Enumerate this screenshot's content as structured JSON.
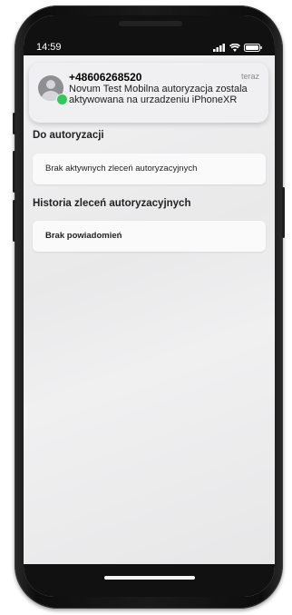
{
  "status_bar": {
    "time": "14:59",
    "signal_icon": "cellular-signal-icon",
    "wifi_icon": "wifi-icon",
    "battery_icon": "battery-icon"
  },
  "notification": {
    "sender": "+48606268520",
    "time": "teraz",
    "message": "Novum Test Mobilna autoryzacja zostala aktywowana na urzadzeniu iPhoneXR",
    "avatar_icon": "contact-avatar-icon",
    "badge_icon": "messages-badge-icon"
  },
  "authorization": {
    "title": "Do autoryzacji",
    "empty_message": "Brak aktywnych zleceń autoryzacyjnych"
  },
  "history": {
    "title": "Historia zleceń autoryzacyjnych",
    "empty_message": "Brak powiadomień"
  },
  "colors": {
    "badge": "#34c759",
    "screen_bg": "#eeeeef",
    "card_bg": "#fafafa"
  }
}
